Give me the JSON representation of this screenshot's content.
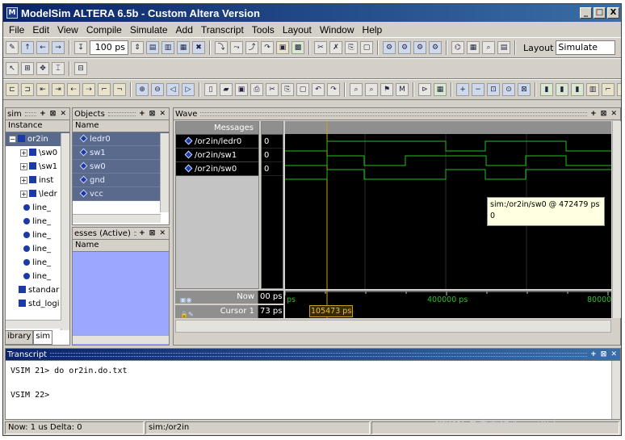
{
  "window": {
    "title": "ModelSim ALTERA 6.5b - Custom Altera Version",
    "controls": [
      "_",
      "□",
      "X"
    ]
  },
  "menu": [
    "File",
    "Edit",
    "View",
    "Compile",
    "Simulate",
    "Add",
    "Transcript",
    "Tools",
    "Layout",
    "Window",
    "Help"
  ],
  "toolbar": {
    "run_length": "100 ps",
    "layout_label": "Layout",
    "layout_value": "Simulate"
  },
  "sim_pane": {
    "title": "sim",
    "column": "Instance",
    "items": [
      {
        "label": "or2in",
        "kind": "module",
        "expanded": true,
        "selected": true
      },
      {
        "label": "\\sw0",
        "kind": "module"
      },
      {
        "label": "\\sw1",
        "kind": "module"
      },
      {
        "label": "inst",
        "kind": "module"
      },
      {
        "label": "\\ledr",
        "kind": "module"
      },
      {
        "label": "line_",
        "kind": "process"
      },
      {
        "label": "line_",
        "kind": "process"
      },
      {
        "label": "line_",
        "kind": "process"
      },
      {
        "label": "line_",
        "kind": "process"
      },
      {
        "label": "line_",
        "kind": "process"
      },
      {
        "label": "line_",
        "kind": "process"
      },
      {
        "label": "standar",
        "kind": "package"
      },
      {
        "label": "std_logi",
        "kind": "package"
      }
    ],
    "tabs": [
      "ibrary",
      "sim"
    ]
  },
  "objects_pane": {
    "title": "Objects",
    "column": "Name",
    "items": [
      "ledr0",
      "sw1",
      "sw0",
      "gnd",
      "vcc"
    ]
  },
  "processes_pane": {
    "title": "esses (Active)",
    "column": "Name"
  },
  "wave": {
    "title": "Wave",
    "messages_header": "Messages",
    "signals": [
      {
        "name": "/or2in/ledr0",
        "value": "0"
      },
      {
        "name": "/or2in/sw1",
        "value": "0"
      },
      {
        "name": "/or2in/sw0",
        "value": "0"
      }
    ],
    "now_label": "Now",
    "now_value": "00 ps",
    "cursor_label": "Cursor 1",
    "cursor_value": "73 ps",
    "cursor_time": "105473 ps",
    "timeline_labels": [
      "ps",
      "400000 ps",
      "80000"
    ],
    "tooltip": {
      "line1": "sim:/or2in/sw0 @ 472479 ps",
      "line2": "0"
    },
    "colors": {
      "wave": "#22c022",
      "background": "#000000",
      "cursor": "#c8a020"
    }
  },
  "transcript": {
    "title": "Transcript",
    "lines": [
      "VSIM 21> do or2in.do.txt",
      "VSIM 22>"
    ]
  },
  "status": {
    "now": "Now: 1 us  Delta: 0",
    "context": "sim:/or2in"
  },
  "watermark": "CSDN @青春猪头mei少女"
}
